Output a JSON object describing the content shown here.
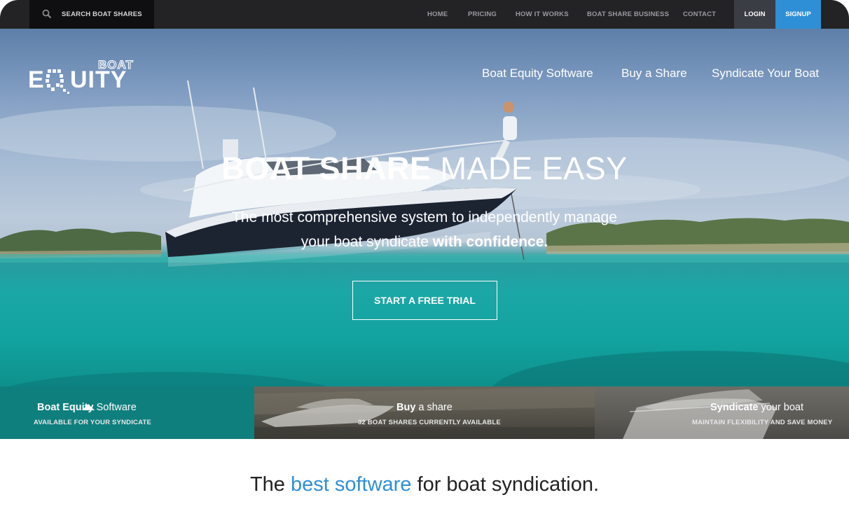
{
  "topbar": {
    "search_label": "SEARCH BOAT SHARES",
    "nav": [
      "HOME",
      "PRICING",
      "HOW IT WORKS",
      "BOAT SHARE BUSINESS",
      "CONTACT"
    ],
    "login": "LOGIN",
    "signup": "SIGNUP"
  },
  "brand": {
    "logo_text_top": "BOAT",
    "logo_text_main": "EQUITY",
    "logo_e": "E",
    "logo_rest": "UITY"
  },
  "hero": {
    "nav": [
      "Boat Equity Software",
      "Buy a Share",
      "Syndicate Your Boat"
    ],
    "headline_bold": "BOAT SHARE",
    "headline_rest": " MADE EASY",
    "sub_line1": "The most comprehensive system to independently manage",
    "sub_line2_plain": "your boat syndicate ",
    "sub_line2_bold": "with confidence.",
    "cta": "START A FREE TRIAL"
  },
  "panels": [
    {
      "title_bold": "Boat Equity",
      "title_rest": " Software",
      "sub": "AVAILABLE FOR YOUR SYNDICATE"
    },
    {
      "title_bold": "Buy",
      "title_rest": " a share",
      "sub": "32 BOAT SHARES CURRENTLY AVAILABLE"
    },
    {
      "title_bold": "Syndicate",
      "title_rest": " your boat",
      "sub": "MAINTAIN FLEXIBILITY AND SAVE MONEY"
    }
  ],
  "tagline": {
    "before": "The ",
    "highlight": "best software",
    "after": " for boat syndication."
  },
  "colors": {
    "accent": "#2f8fd6",
    "topbar": "#232326",
    "water": "#12a39f"
  }
}
